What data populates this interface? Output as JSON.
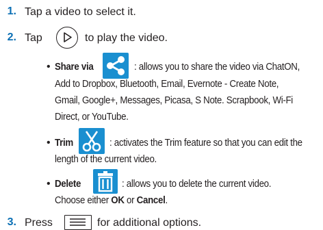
{
  "steps": [
    {
      "num": "1.",
      "text": "Tap a video to select it."
    },
    {
      "num": "2.",
      "text_before": "Tap",
      "text_after": "to play the video."
    },
    {
      "num": "3.",
      "text_before": "Press",
      "text_after": "for additional options."
    }
  ],
  "share": {
    "label": "Share via",
    "line1": ": allows you to share the video via ChatON,",
    "line2": "Add to Dropbox, Bluetooth, Email, Evernote - Create Note,",
    "line3": "Gmail, Google+, Messages, Picasa, S Note. Scrapbook, Wi-Fi",
    "line4": "Direct, or YouTube."
  },
  "trim": {
    "label": "Trim",
    "line1": ": activates the Trim feature so that you can edit the",
    "line2": "length of the current video."
  },
  "delete": {
    "label": "Delete",
    "line1": ": allows you to delete the current video.",
    "line2_a": "Choose either",
    "ok": "OK",
    "line2_b": "or",
    "cancel": "Cancel",
    "line2_c": "."
  },
  "bullet_char": "•",
  "icons": {
    "play": "play-icon",
    "share": "share-icon",
    "trim": "scissors-icon",
    "delete": "trash-icon",
    "menu": "menu-icon"
  },
  "colors": {
    "step_number": "#0a6fb4",
    "icon_bg": "#1a8fd0",
    "text": "#231f20"
  }
}
